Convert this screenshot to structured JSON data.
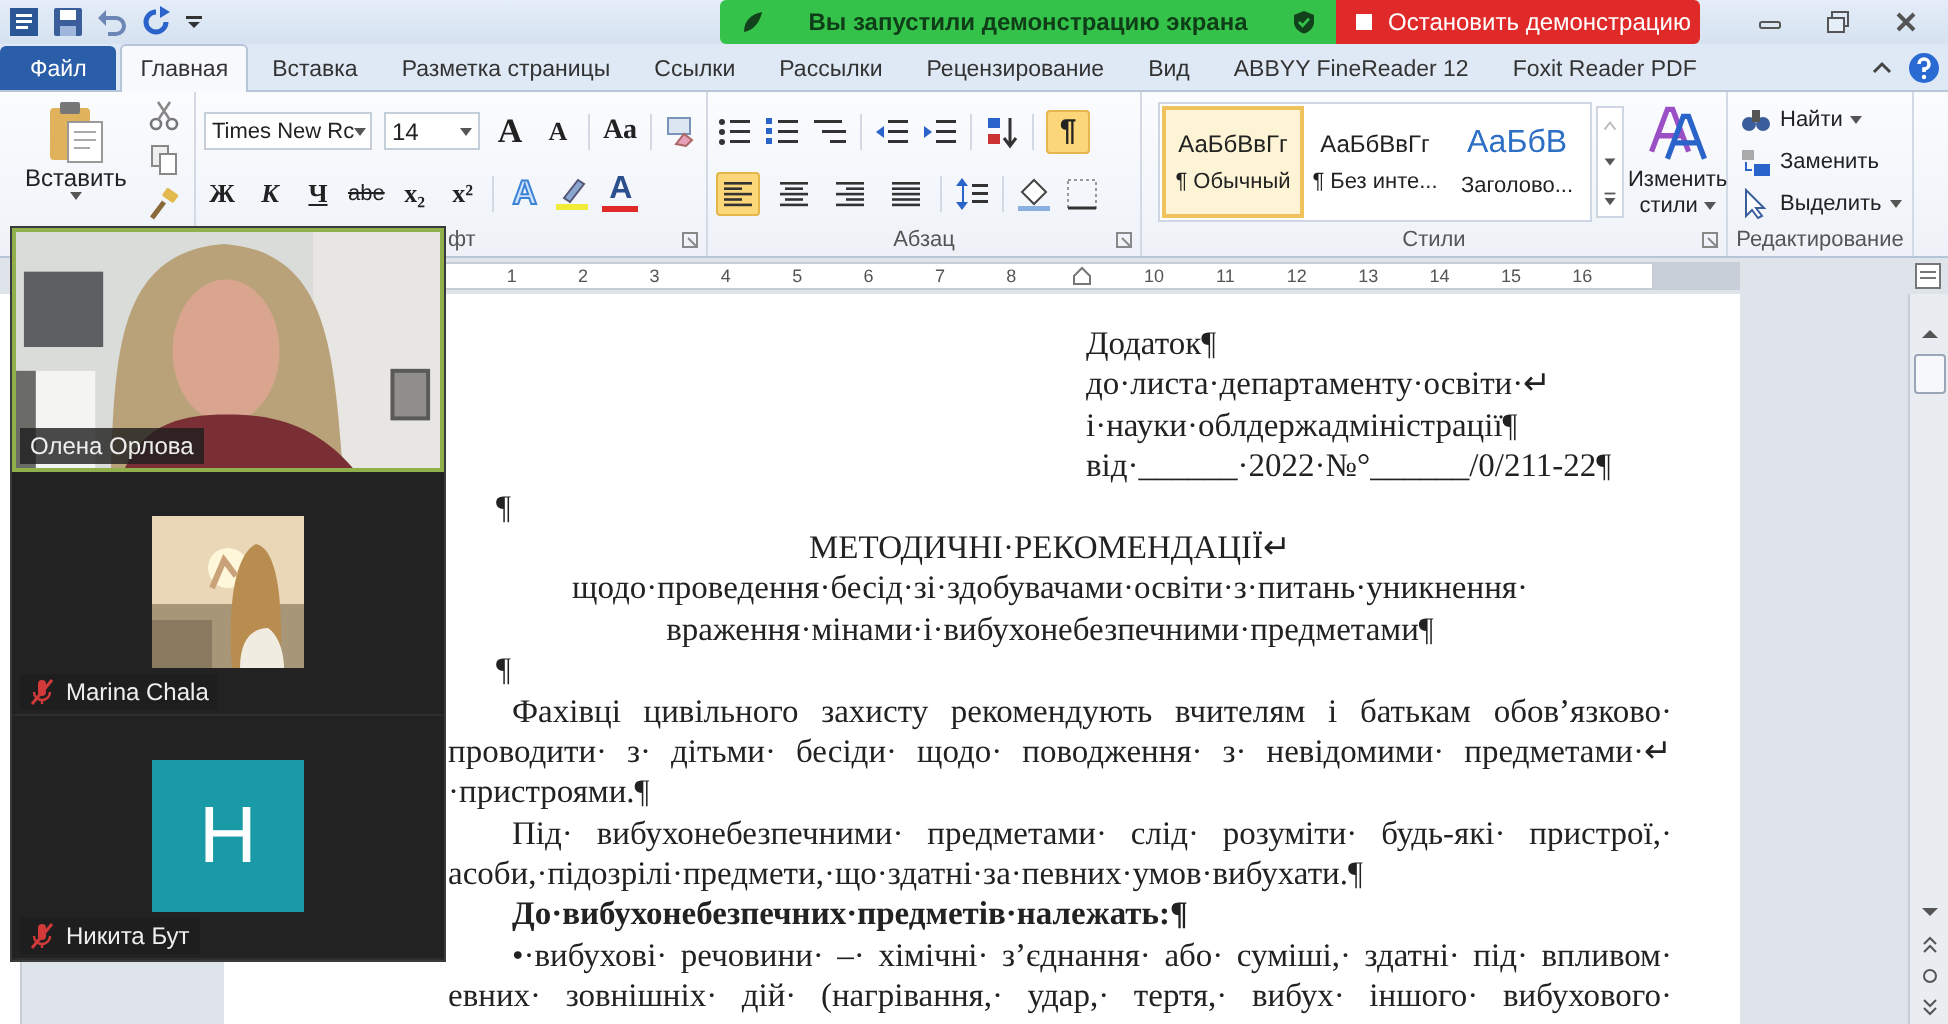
{
  "title_bar": {
    "banner_message": "Вы запустили демонстрацию экрана",
    "stop_label": "Остановить демонстрацию"
  },
  "tabs": [
    {
      "label": "Файл",
      "kind": "file",
      "selected": false
    },
    {
      "label": "Главная",
      "kind": "tab",
      "selected": true
    },
    {
      "label": "Вставка",
      "kind": "tab",
      "selected": false
    },
    {
      "label": "Разметка страницы",
      "kind": "tab",
      "selected": false
    },
    {
      "label": "Ссылки",
      "kind": "tab",
      "selected": false
    },
    {
      "label": "Рассылки",
      "kind": "tab",
      "selected": false
    },
    {
      "label": "Рецензирование",
      "kind": "tab",
      "selected": false
    },
    {
      "label": "Вид",
      "kind": "tab",
      "selected": false
    },
    {
      "label": "ABBYY FineReader 12",
      "kind": "tab",
      "selected": false
    },
    {
      "label": "Foxit Reader PDF",
      "kind": "tab",
      "selected": false
    }
  ],
  "ribbon": {
    "clipboard": {
      "paste_label": "Вставить"
    },
    "font": {
      "label": "фт",
      "font_name": "Times New Rc",
      "font_size": "14",
      "grow": "A",
      "shrink": "A",
      "case": "Aa",
      "effects": "A",
      "color_letter": "A",
      "styles": [
        {
          "label": "Ж",
          "kind": "bold"
        },
        {
          "label": "К",
          "kind": "italic"
        },
        {
          "label": "Ч",
          "kind": "underline"
        },
        {
          "label": "abe",
          "kind": "strike"
        },
        {
          "label": "x₂",
          "kind": "sub"
        },
        {
          "label": "x²",
          "kind": "sup"
        }
      ]
    },
    "paragraph": {
      "label": "Абзац",
      "show_marks_symbol": "¶",
      "show_marks": true,
      "align": [
        {
          "kind": "left",
          "selected": true
        },
        {
          "kind": "center",
          "selected": false
        },
        {
          "kind": "right",
          "selected": false
        },
        {
          "kind": "justify",
          "selected": false
        }
      ]
    },
    "styles": {
      "label": "Стили",
      "change_label": "Изменить стили",
      "items": [
        {
          "sample": "АаБбВвГг",
          "name": "¶ Обычный",
          "kind": "normal",
          "selected": true
        },
        {
          "sample": "АаБбВвГг",
          "name": "¶ Без инте...",
          "kind": "normal",
          "selected": false
        },
        {
          "sample": "АаБбВ",
          "name": "Заголово...",
          "kind": "heading",
          "selected": false
        }
      ]
    },
    "editing": {
      "label": "Редактирование",
      "actions": [
        {
          "label": "Найти",
          "kind": "find"
        },
        {
          "label": "Заменить",
          "kind": "replace"
        },
        {
          "label": "Выделить",
          "kind": "select"
        }
      ]
    }
  },
  "ruler": [
    {
      "kind": "number",
      "label": "1"
    },
    {
      "kind": "number",
      "label": "2"
    },
    {
      "kind": "number",
      "label": "3"
    },
    {
      "kind": "number",
      "label": "4"
    },
    {
      "kind": "number",
      "label": "5"
    },
    {
      "kind": "number",
      "label": "6"
    },
    {
      "kind": "number",
      "label": "7"
    },
    {
      "kind": "number",
      "label": "8"
    },
    {
      "kind": "marker"
    },
    {
      "kind": "number",
      "label": "10"
    },
    {
      "kind": "number",
      "label": "11"
    },
    {
      "kind": "number",
      "label": "12"
    },
    {
      "kind": "number",
      "label": "13"
    },
    {
      "kind": "number",
      "label": "14"
    },
    {
      "kind": "number",
      "label": "15"
    },
    {
      "kind": "number",
      "label": "16"
    }
  ],
  "document": [
    {
      "kind": "block",
      "bold": false,
      "text": "Додаток¶"
    },
    {
      "kind": "block",
      "bold": false,
      "text": "до·листа·департаменту·освіти·↵"
    },
    {
      "kind": "block",
      "bold": false,
      "text": "і·науки·облдержадміністрації¶"
    },
    {
      "kind": "block",
      "bold": false,
      "text": "від·______·2022·№°______/0/211-22¶"
    },
    {
      "kind": "mark",
      "bold": false,
      "text": "¶"
    },
    {
      "kind": "center",
      "bold": false,
      "text": "МЕТОДИЧНІ·РЕКОМЕНДАЦІЇ↵"
    },
    {
      "kind": "center",
      "bold": false,
      "text": "щодо·проведення·бесід·зі·здобувачами·освіти·з·питань·уникнення·"
    },
    {
      "kind": "center",
      "bold": false,
      "text": "враження·мінами·і·вибухонебезпечними·предметами¶"
    },
    {
      "kind": "mark",
      "bold": false,
      "text": "¶"
    },
    {
      "kind": "indent-justify",
      "bold": false,
      "text": "Фахівці цивільного захисту рекомендують вчителям і батькам обов’язково·"
    },
    {
      "kind": "justify",
      "bold": false,
      "text": "проводити· з· дітьми· бесіди· щодо· поводження· з· невідомими· предметами·↵"
    },
    {
      "kind": "left",
      "bold": false,
      "text": "·пристроями.¶"
    },
    {
      "kind": "indent-justify",
      "bold": false,
      "text": "Під· вибухонебезпечними· предметами· слід· розуміти· будь-які· пристрої,·"
    },
    {
      "kind": "left",
      "bold": false,
      "text": "асоби,·підозрілі·предмети,·що·здатні·за·певних·умов·вибухати.¶"
    },
    {
      "kind": "indent",
      "bold": true,
      "text": "До·вибухонебезпечних·предметів·належать:¶"
    },
    {
      "kind": "indent-justify",
      "bold": false,
      "text": "•·вибухові· речовини· –· хімічні· з’єднання· або· суміші,· здатні· під· впливом·"
    },
    {
      "kind": "justify",
      "bold": false,
      "text": "евних· зовнішніх· дій· (нагрівання,· удар,· тертя,· вибух· іншого· вибухового·"
    }
  ],
  "participants": [
    {
      "name": "Олена Орлова",
      "kind": "video",
      "speaking": true,
      "muted": false
    },
    {
      "name": "Marina Chala",
      "speaking": false,
      "muted": true
    },
    {
      "name": "Никита Бут",
      "kind": "initial",
      "initial": "H",
      "speaking": false,
      "muted": true
    }
  ]
}
